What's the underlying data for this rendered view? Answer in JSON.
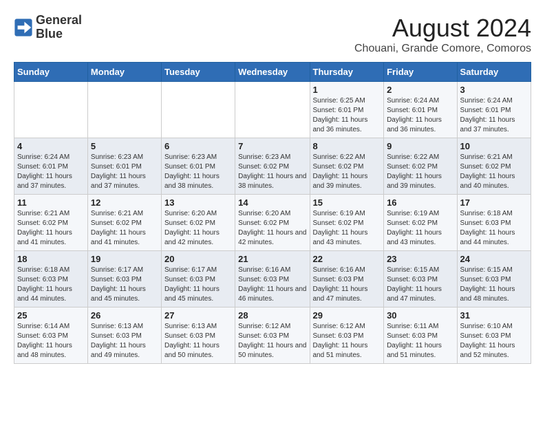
{
  "logo": {
    "line1": "General",
    "line2": "Blue"
  },
  "title": "August 2024",
  "subtitle": "Chouani, Grande Comore, Comoros",
  "days_of_week": [
    "Sunday",
    "Monday",
    "Tuesday",
    "Wednesday",
    "Thursday",
    "Friday",
    "Saturday"
  ],
  "weeks": [
    [
      {
        "num": "",
        "detail": ""
      },
      {
        "num": "",
        "detail": ""
      },
      {
        "num": "",
        "detail": ""
      },
      {
        "num": "",
        "detail": ""
      },
      {
        "num": "1",
        "detail": "Sunrise: 6:25 AM\nSunset: 6:01 PM\nDaylight: 11 hours\nand 36 minutes."
      },
      {
        "num": "2",
        "detail": "Sunrise: 6:24 AM\nSunset: 6:01 PM\nDaylight: 11 hours\nand 36 minutes."
      },
      {
        "num": "3",
        "detail": "Sunrise: 6:24 AM\nSunset: 6:01 PM\nDaylight: 11 hours\nand 37 minutes."
      }
    ],
    [
      {
        "num": "4",
        "detail": "Sunrise: 6:24 AM\nSunset: 6:01 PM\nDaylight: 11 hours\nand 37 minutes."
      },
      {
        "num": "5",
        "detail": "Sunrise: 6:23 AM\nSunset: 6:01 PM\nDaylight: 11 hours\nand 37 minutes."
      },
      {
        "num": "6",
        "detail": "Sunrise: 6:23 AM\nSunset: 6:01 PM\nDaylight: 11 hours\nand 38 minutes."
      },
      {
        "num": "7",
        "detail": "Sunrise: 6:23 AM\nSunset: 6:02 PM\nDaylight: 11 hours\nand 38 minutes."
      },
      {
        "num": "8",
        "detail": "Sunrise: 6:22 AM\nSunset: 6:02 PM\nDaylight: 11 hours\nand 39 minutes."
      },
      {
        "num": "9",
        "detail": "Sunrise: 6:22 AM\nSunset: 6:02 PM\nDaylight: 11 hours\nand 39 minutes."
      },
      {
        "num": "10",
        "detail": "Sunrise: 6:21 AM\nSunset: 6:02 PM\nDaylight: 11 hours\nand 40 minutes."
      }
    ],
    [
      {
        "num": "11",
        "detail": "Sunrise: 6:21 AM\nSunset: 6:02 PM\nDaylight: 11 hours\nand 41 minutes."
      },
      {
        "num": "12",
        "detail": "Sunrise: 6:21 AM\nSunset: 6:02 PM\nDaylight: 11 hours\nand 41 minutes."
      },
      {
        "num": "13",
        "detail": "Sunrise: 6:20 AM\nSunset: 6:02 PM\nDaylight: 11 hours\nand 42 minutes."
      },
      {
        "num": "14",
        "detail": "Sunrise: 6:20 AM\nSunset: 6:02 PM\nDaylight: 11 hours\nand 42 minutes."
      },
      {
        "num": "15",
        "detail": "Sunrise: 6:19 AM\nSunset: 6:02 PM\nDaylight: 11 hours\nand 43 minutes."
      },
      {
        "num": "16",
        "detail": "Sunrise: 6:19 AM\nSunset: 6:02 PM\nDaylight: 11 hours\nand 43 minutes."
      },
      {
        "num": "17",
        "detail": "Sunrise: 6:18 AM\nSunset: 6:03 PM\nDaylight: 11 hours\nand 44 minutes."
      }
    ],
    [
      {
        "num": "18",
        "detail": "Sunrise: 6:18 AM\nSunset: 6:03 PM\nDaylight: 11 hours\nand 44 minutes."
      },
      {
        "num": "19",
        "detail": "Sunrise: 6:17 AM\nSunset: 6:03 PM\nDaylight: 11 hours\nand 45 minutes."
      },
      {
        "num": "20",
        "detail": "Sunrise: 6:17 AM\nSunset: 6:03 PM\nDaylight: 11 hours\nand 45 minutes."
      },
      {
        "num": "21",
        "detail": "Sunrise: 6:16 AM\nSunset: 6:03 PM\nDaylight: 11 hours\nand 46 minutes."
      },
      {
        "num": "22",
        "detail": "Sunrise: 6:16 AM\nSunset: 6:03 PM\nDaylight: 11 hours\nand 47 minutes."
      },
      {
        "num": "23",
        "detail": "Sunrise: 6:15 AM\nSunset: 6:03 PM\nDaylight: 11 hours\nand 47 minutes."
      },
      {
        "num": "24",
        "detail": "Sunrise: 6:15 AM\nSunset: 6:03 PM\nDaylight: 11 hours\nand 48 minutes."
      }
    ],
    [
      {
        "num": "25",
        "detail": "Sunrise: 6:14 AM\nSunset: 6:03 PM\nDaylight: 11 hours\nand 48 minutes."
      },
      {
        "num": "26",
        "detail": "Sunrise: 6:13 AM\nSunset: 6:03 PM\nDaylight: 11 hours\nand 49 minutes."
      },
      {
        "num": "27",
        "detail": "Sunrise: 6:13 AM\nSunset: 6:03 PM\nDaylight: 11 hours\nand 50 minutes."
      },
      {
        "num": "28",
        "detail": "Sunrise: 6:12 AM\nSunset: 6:03 PM\nDaylight: 11 hours\nand 50 minutes."
      },
      {
        "num": "29",
        "detail": "Sunrise: 6:12 AM\nSunset: 6:03 PM\nDaylight: 11 hours\nand 51 minutes."
      },
      {
        "num": "30",
        "detail": "Sunrise: 6:11 AM\nSunset: 6:03 PM\nDaylight: 11 hours\nand 51 minutes."
      },
      {
        "num": "31",
        "detail": "Sunrise: 6:10 AM\nSunset: 6:03 PM\nDaylight: 11 hours\nand 52 minutes."
      }
    ]
  ]
}
